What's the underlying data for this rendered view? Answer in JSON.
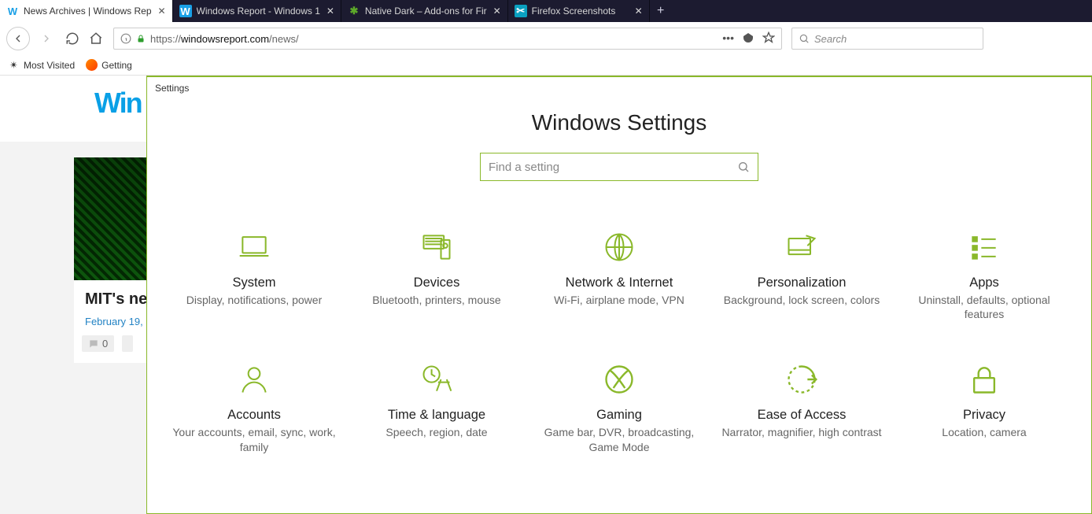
{
  "tabs": [
    {
      "title": "News Archives | Windows Rep",
      "active": true
    },
    {
      "title": "Windows Report - Windows 1",
      "active": false
    },
    {
      "title": "Native Dark – Add-ons for Fir",
      "active": false
    },
    {
      "title": "Firefox Screenshots",
      "active": false
    }
  ],
  "url": {
    "scheme": "https://",
    "host": "windowsreport.com",
    "path": "/news/"
  },
  "search_placeholder": "Search",
  "bookmarks": {
    "most_visited": "Most Visited",
    "getting_started": "Getting"
  },
  "site": {
    "logo": "Win"
  },
  "article": {
    "title": "MIT's ne\nchip will",
    "date": "February 19,",
    "comments": "0"
  },
  "settings": {
    "window_title": "Settings",
    "heading": "Windows Settings",
    "search_placeholder": "Find a setting",
    "categories": [
      {
        "key": "system",
        "title": "System",
        "desc": "Display, notifications, power"
      },
      {
        "key": "devices",
        "title": "Devices",
        "desc": "Bluetooth, printers, mouse"
      },
      {
        "key": "network",
        "title": "Network & Internet",
        "desc": "Wi-Fi, airplane mode, VPN"
      },
      {
        "key": "personalization",
        "title": "Personalization",
        "desc": "Background, lock screen, colors"
      },
      {
        "key": "apps",
        "title": "Apps",
        "desc": "Uninstall, defaults, optional features"
      },
      {
        "key": "accounts",
        "title": "Accounts",
        "desc": "Your accounts, email, sync, work, family"
      },
      {
        "key": "time",
        "title": "Time & language",
        "desc": "Speech, region, date"
      },
      {
        "key": "gaming",
        "title": "Gaming",
        "desc": "Game bar, DVR, broadcasting, Game Mode"
      },
      {
        "key": "ease",
        "title": "Ease of Access",
        "desc": "Narrator, magnifier, high contrast"
      },
      {
        "key": "privacy",
        "title": "Privacy",
        "desc": "Location, camera"
      }
    ]
  }
}
